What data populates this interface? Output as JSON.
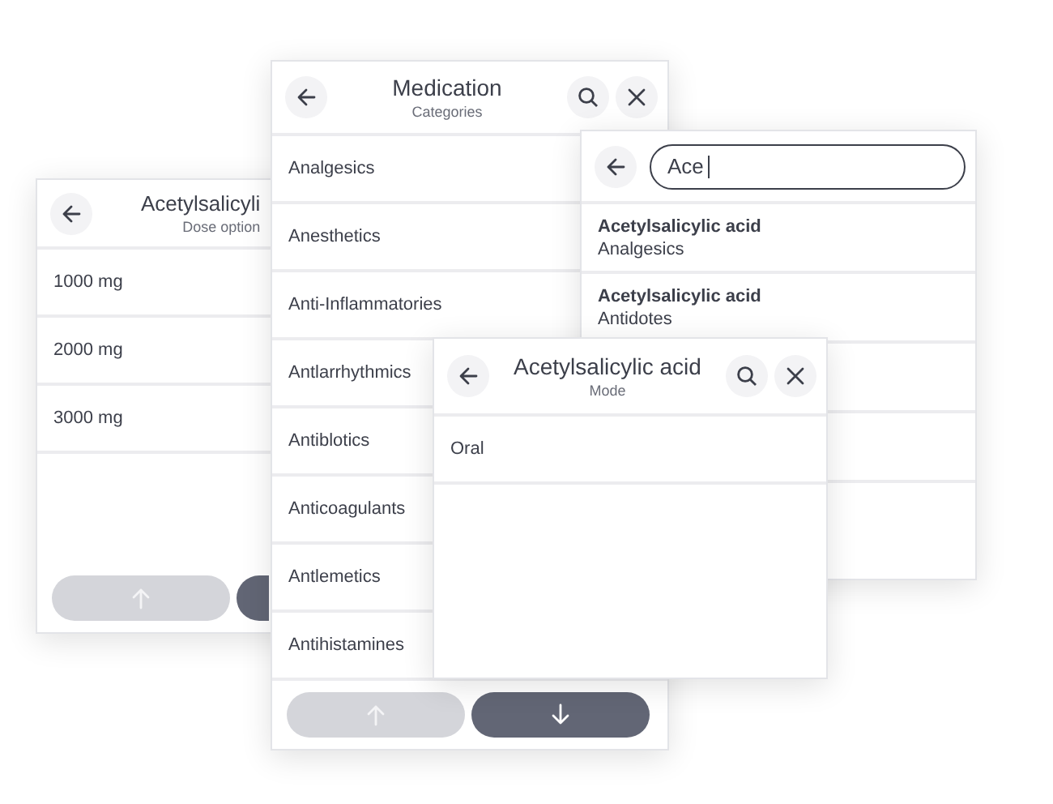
{
  "dose_panel": {
    "title": "Acetylsalicyli",
    "subtitle": "Dose option",
    "options": [
      {
        "label": "1000 mg"
      },
      {
        "label": "2000 mg"
      },
      {
        "label": "3000 mg"
      }
    ],
    "buttons": [
      {
        "kind": "up",
        "enabled": false
      },
      {
        "kind": "down",
        "enabled": true
      }
    ]
  },
  "medication_panel": {
    "title": "Medication",
    "subtitle": "Categories",
    "categories": [
      {
        "label": "Analgesics"
      },
      {
        "label": "Anesthetics"
      },
      {
        "label": "Anti-Inflammatories"
      },
      {
        "label": "Antlarrhythmics"
      },
      {
        "label": "Antiblotics"
      },
      {
        "label": "Anticoagulants"
      },
      {
        "label": "Antlemetics"
      },
      {
        "label": "Antihistamines"
      }
    ],
    "buttons": [
      {
        "kind": "up",
        "enabled": false
      },
      {
        "kind": "down",
        "enabled": true
      }
    ]
  },
  "search_panel": {
    "search": {
      "value": "Ace",
      "focused": true
    },
    "results": [
      {
        "name": "Acetylsalicylic acid",
        "category": "Analgesics"
      },
      {
        "name": "Acetylsalicylic acid",
        "category": "Antidotes"
      }
    ]
  },
  "mode_panel": {
    "title": "Acetylsalicylic acid",
    "subtitle": "Mode",
    "options": [
      {
        "label": "Oral"
      }
    ]
  }
}
